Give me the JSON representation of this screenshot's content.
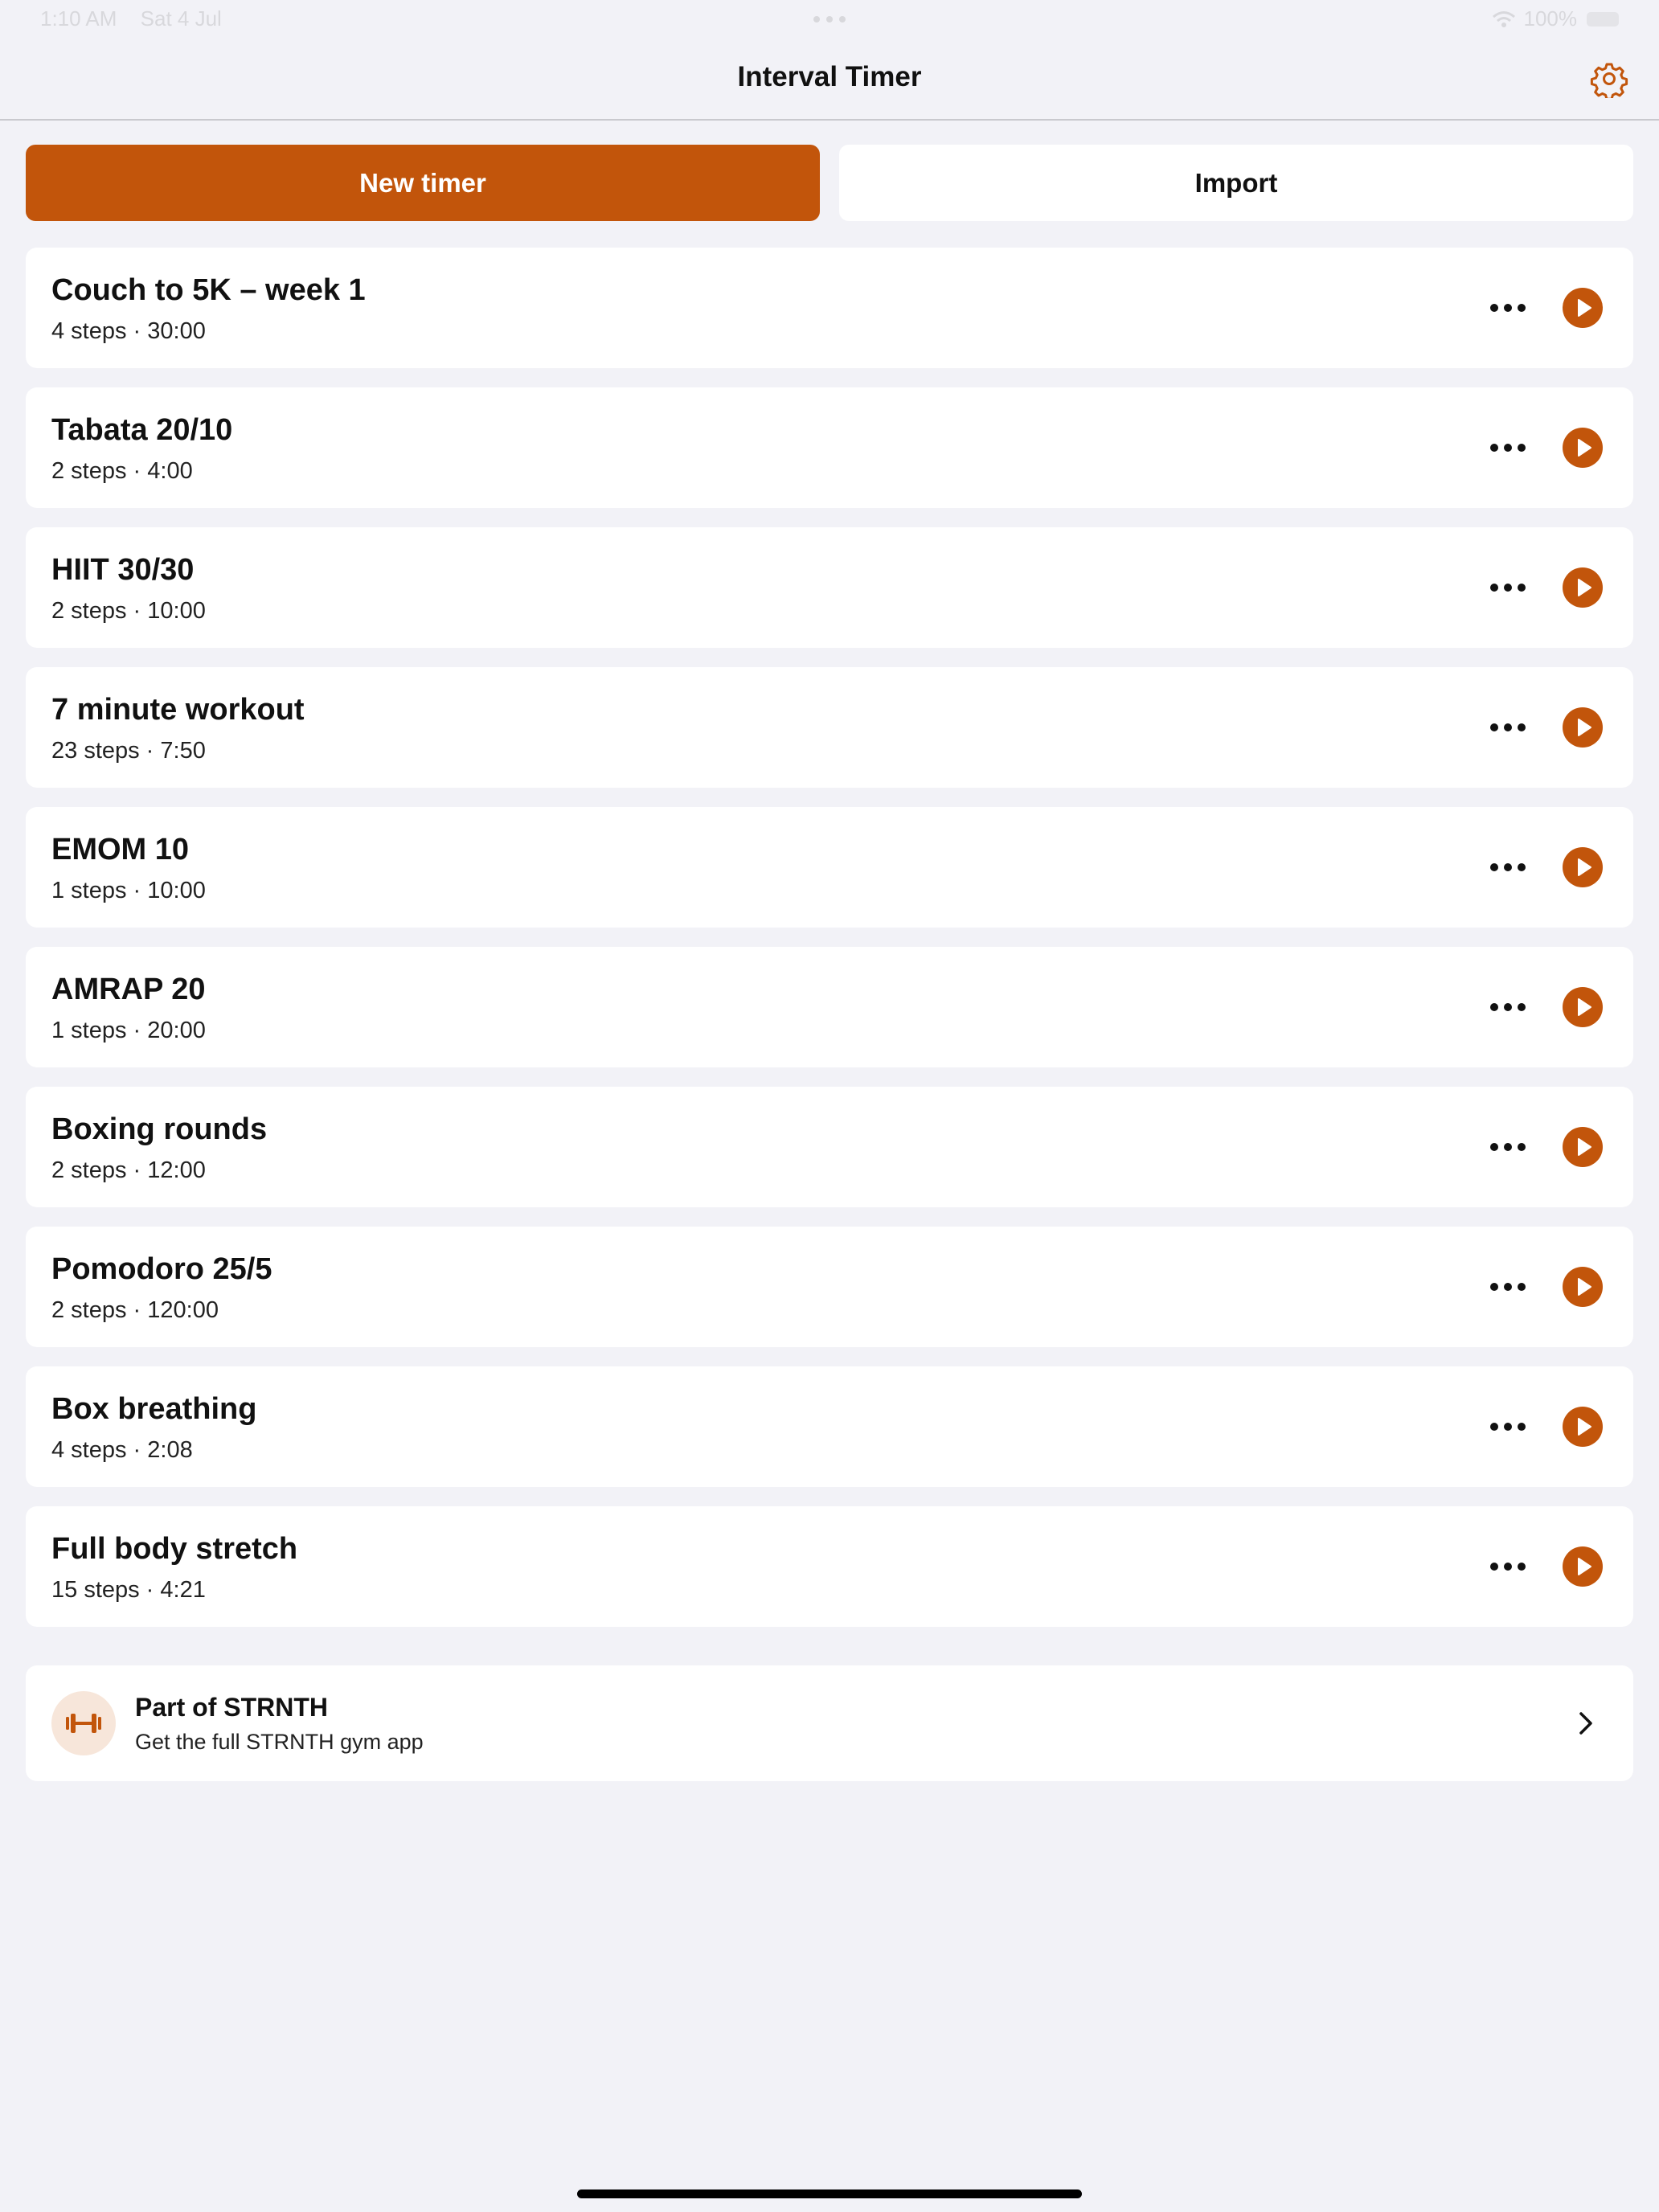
{
  "status_bar": {
    "time": "1:10 AM",
    "date": "Sat 4 Jul",
    "battery": "100%"
  },
  "nav": {
    "title": "Interval Timer",
    "settings_icon": "gear-icon"
  },
  "actions": {
    "new_timer": "New timer",
    "import": "Import"
  },
  "timers": [
    {
      "name": "Couch to 5K – week 1",
      "meta": "4 steps · 30:00"
    },
    {
      "name": "Tabata 20/10",
      "meta": "2 steps · 4:00"
    },
    {
      "name": "HIIT 30/30",
      "meta": "2 steps · 10:00"
    },
    {
      "name": "7 minute workout",
      "meta": "23 steps · 7:50"
    },
    {
      "name": "EMOM 10",
      "meta": "1 steps · 10:00"
    },
    {
      "name": "AMRAP 20",
      "meta": "1 steps · 20:00"
    },
    {
      "name": "Boxing rounds",
      "meta": "2 steps · 12:00"
    },
    {
      "name": "Pomodoro 25/5",
      "meta": "2 steps · 120:00"
    },
    {
      "name": "Box breathing",
      "meta": "4 steps · 2:08"
    },
    {
      "name": "Full body stretch",
      "meta": "15 steps · 4:21"
    }
  ],
  "promo": {
    "title": "Part of STRNTH",
    "subtitle": "Get the full STRNTH gym app",
    "icon": "dumbbell-icon"
  },
  "colors": {
    "accent": "#c2550b",
    "background": "#f2f2f7",
    "card": "#ffffff",
    "promo_icon_bg": "#f7e6da"
  }
}
